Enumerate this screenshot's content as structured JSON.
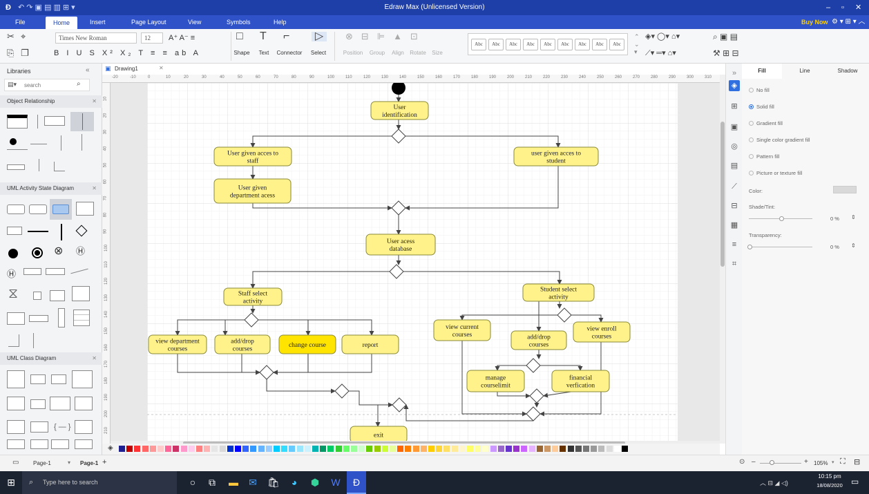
{
  "app": {
    "title": "Edraw Max (Unlicensed Version)"
  },
  "menu": {
    "items": [
      {
        "key": "file",
        "label": "File"
      },
      {
        "key": "home",
        "label": "Home"
      },
      {
        "key": "insert",
        "label": "Insert"
      },
      {
        "key": "page-layout",
        "label": "Page Layout"
      },
      {
        "key": "view",
        "label": "View"
      },
      {
        "key": "symbols",
        "label": "Symbols"
      },
      {
        "key": "help",
        "label": "Help"
      }
    ],
    "active": "Home",
    "buy_now": "Buy Now"
  },
  "ribbon": {
    "font_name": "Times New Roman",
    "font_size": "12",
    "tools": [
      {
        "key": "shape",
        "label": "Shape"
      },
      {
        "key": "text",
        "label": "Text"
      },
      {
        "key": "connector",
        "label": "Connector"
      },
      {
        "key": "select",
        "label": "Select"
      }
    ],
    "arrange": [
      {
        "key": "position",
        "label": "Position"
      },
      {
        "key": "group",
        "label": "Group"
      },
      {
        "key": "align",
        "label": "Align"
      },
      {
        "key": "rotate",
        "label": "Rotate"
      },
      {
        "key": "size",
        "label": "Size"
      }
    ],
    "style_sample": "Abc"
  },
  "libraries": {
    "title": "Libraries",
    "search_placeholder": "search",
    "sections": [
      {
        "key": "object-relationship",
        "label": "Object Relationship"
      },
      {
        "key": "uml-activity-state",
        "label": "UML Activity State Diagram"
      },
      {
        "key": "uml-class",
        "label": "UML Class Diagram"
      }
    ]
  },
  "document": {
    "tab": "Drawing1"
  },
  "ruler": {
    "h_ticks": [
      "-20",
      "-10",
      "0",
      "10",
      "20",
      "30",
      "40",
      "50",
      "60",
      "70",
      "80",
      "90",
      "100",
      "110",
      "120",
      "130",
      "140",
      "150",
      "160",
      "170",
      "180",
      "190",
      "200",
      "210",
      "220",
      "230",
      "240",
      "250",
      "260",
      "270",
      "280",
      "290",
      "300",
      "310"
    ],
    "v_ticks": [
      "10",
      "20",
      "30",
      "40",
      "50",
      "60",
      "70",
      "80",
      "90",
      "100",
      "110",
      "120",
      "130",
      "140",
      "150",
      "160",
      "170",
      "180",
      "190",
      "200",
      "210",
      "220"
    ]
  },
  "diagram": {
    "nodes": [
      {
        "key": "user-identification",
        "label": "User identification"
      },
      {
        "key": "staff-access",
        "label": "User given acces to staff"
      },
      {
        "key": "student-access",
        "label": "user given acces to student"
      },
      {
        "key": "department-access",
        "label": "User given department acess"
      },
      {
        "key": "access-database",
        "label": "User acess database"
      },
      {
        "key": "staff-select",
        "label": "Staff select activity"
      },
      {
        "key": "student-select",
        "label": "Student select activity"
      },
      {
        "key": "view-dept-courses",
        "label": "view department courses"
      },
      {
        "key": "staff-add-drop",
        "label": "add/drop courses"
      },
      {
        "key": "change-course",
        "label": "change course"
      },
      {
        "key": "report",
        "label": "report"
      },
      {
        "key": "view-current-courses",
        "label": "view current courses"
      },
      {
        "key": "student-add-drop",
        "label": "add/drop courses"
      },
      {
        "key": "view-enroll-courses",
        "label": "view enroll courses"
      },
      {
        "key": "manage-courselimit",
        "label": "manage courselimit"
      },
      {
        "key": "financial-verification",
        "label": "financial verfication"
      },
      {
        "key": "exit",
        "label": "exit"
      }
    ],
    "colors": {
      "node_fill": "#fff28a",
      "node_selected_fill": "#ffe400",
      "node_border": "#8a8a3a",
      "connector": "#444444"
    }
  },
  "properties": {
    "tabs": [
      {
        "key": "fill",
        "label": "Fill"
      },
      {
        "key": "line",
        "label": "Line"
      },
      {
        "key": "shadow",
        "label": "Shadow"
      }
    ],
    "fill_options": [
      {
        "key": "no-fill",
        "label": "No fill",
        "selected": false
      },
      {
        "key": "solid-fill",
        "label": "Solid fill",
        "selected": true
      },
      {
        "key": "gradient-fill",
        "label": "Gradient fill",
        "selected": false
      },
      {
        "key": "single-color-gradient-fill",
        "label": "Single color gradient fill",
        "selected": false
      },
      {
        "key": "pattern-fill",
        "label": "Pattern fill",
        "selected": false
      },
      {
        "key": "picture-fill",
        "label": "Picture or texture fill",
        "selected": false
      }
    ],
    "color_label": "Color:",
    "shade_label": "Shade/Tint:",
    "shade_value": "0 %",
    "transparency_label": "Transparency:",
    "transparency_value": "0 %"
  },
  "status": {
    "page_label": "Page-1",
    "page_tab": "Page-1",
    "zoom": "105%"
  },
  "palette": [
    "#1f1f8f",
    "#c00000",
    "#ff3333",
    "#ff6666",
    "#ff9999",
    "#ffcccc",
    "#ff6699",
    "#cc3366",
    "#ff99cc",
    "#ffccee",
    "#ff8080",
    "#ffb3b3",
    "#e6e6e6",
    "#d9d9d9",
    "#0033cc",
    "#0000ff",
    "#3366ff",
    "#3399ff",
    "#66b3ff",
    "#99ccff",
    "#00ccff",
    "#33ddff",
    "#66ccff",
    "#99e6ff",
    "#ccf2ff",
    "#00b3b3",
    "#009966",
    "#00cc66",
    "#33cc33",
    "#66ff66",
    "#99ff99",
    "#ccffcc",
    "#66cc00",
    "#99cc00",
    "#ccff33",
    "#e6ff99",
    "#ff6600",
    "#ff8000",
    "#ff9933",
    "#ffb366",
    "#ffcc00",
    "#ffd633",
    "#ffe066",
    "#ffeb99",
    "#fff5cc",
    "#ffff66",
    "#ffff99",
    "#ffffcc",
    "#cc99ff",
    "#9966cc",
    "#6633cc",
    "#9933cc",
    "#cc66ff",
    "#e6b3ff",
    "#996633",
    "#cc9966",
    "#ffcc99",
    "#663300",
    "#333333",
    "#555555",
    "#777777",
    "#999999",
    "#bbbbbb",
    "#dddddd",
    "#ffffff",
    "#000000"
  ],
  "taskbar": {
    "search_placeholder": "Type here to search",
    "time": "10:15 pm",
    "date": "18/08/2020"
  }
}
